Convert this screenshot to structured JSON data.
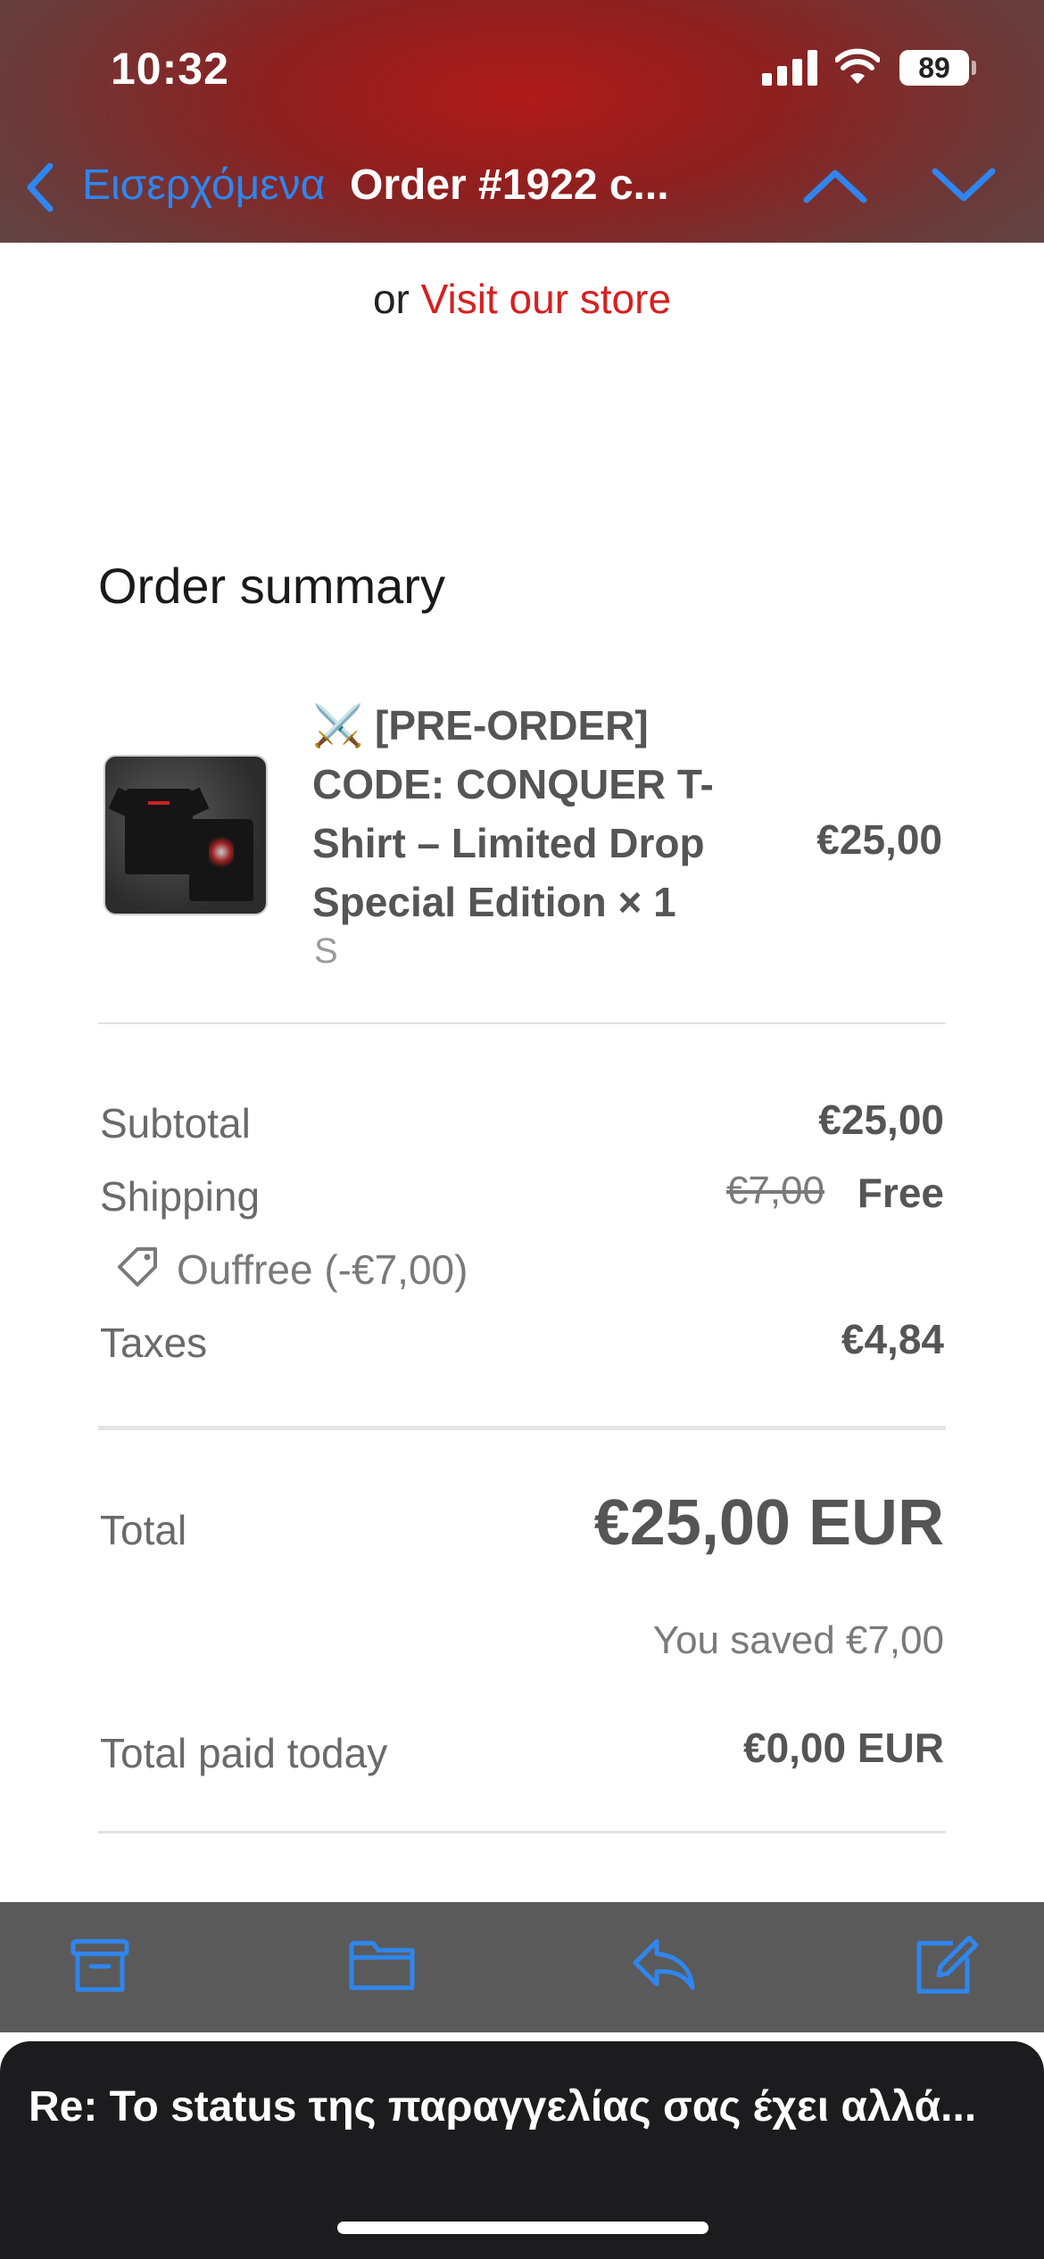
{
  "status_bar": {
    "time": "10:32",
    "battery": "89"
  },
  "nav": {
    "back_label": "Εισερχόμενα",
    "title": "Order #1922 c..."
  },
  "visit": {
    "prefix": "or",
    "link": "Visit our store"
  },
  "summary": {
    "title": "Order summary",
    "item": {
      "name": "⚔️ [PRE-ORDER] CODE: CONQUER T-Shirt – Limited Drop Special Edition × 1",
      "variant": "S",
      "price": "€25,00"
    },
    "subtotal": {
      "label": "Subtotal",
      "value": "€25,00"
    },
    "shipping": {
      "label": "Shipping",
      "original": "€7,00",
      "value": "Free"
    },
    "discount": {
      "label": "Ouffree (-€7,00)"
    },
    "taxes": {
      "label": "Taxes",
      "value": "€4,84"
    },
    "total": {
      "label": "Total",
      "value": "€25,00 EUR"
    },
    "saved": "You saved €7,00",
    "paid_today": {
      "label": "Total paid today",
      "value": "€0,00 EUR"
    }
  },
  "reply_banner": {
    "text": "Re: Το status της παραγγελίας σας έχει αλλά..."
  },
  "colors": {
    "accent": "#2f86ee",
    "link_red": "#d52020",
    "header_red": "#b01a1a"
  },
  "icons": [
    "back-chevron-icon",
    "up-chevron-icon",
    "down-chevron-icon",
    "tag-icon",
    "archive-icon",
    "folder-icon",
    "reply-icon",
    "compose-icon"
  ]
}
